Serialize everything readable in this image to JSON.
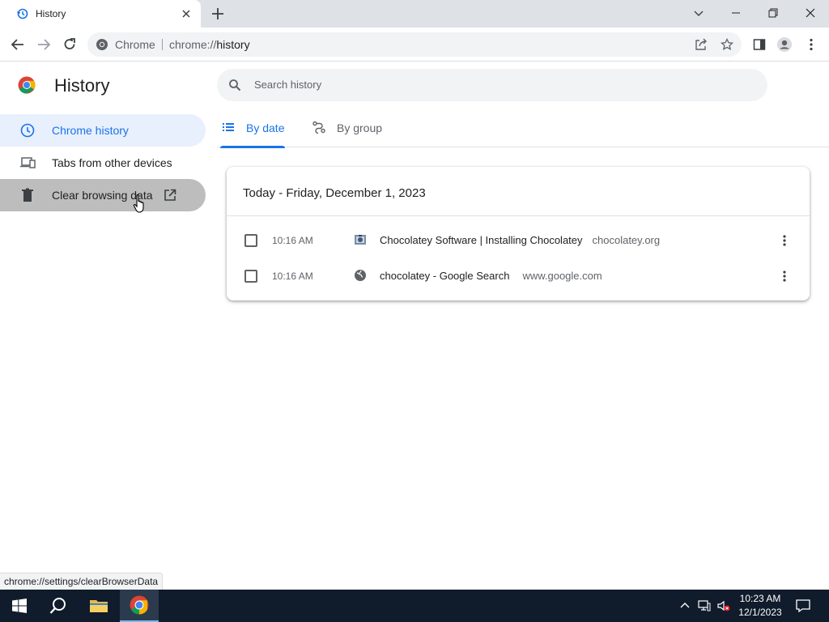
{
  "browser": {
    "tab_title": "History",
    "omnibox": {
      "chip": "Chrome",
      "url_scheme": "chrome://",
      "url_host": "history"
    }
  },
  "page": {
    "title": "History",
    "search_placeholder": "Search history",
    "sidebar": [
      {
        "label": "Chrome history",
        "icon": "clock-icon",
        "state": "selected"
      },
      {
        "label": "Tabs from other devices",
        "icon": "devices-icon",
        "state": "normal"
      },
      {
        "label": "Clear browsing data",
        "icon": "trash-icon",
        "state": "hover"
      }
    ],
    "view_tabs": [
      {
        "label": "By date",
        "icon": "list-icon",
        "selected": true
      },
      {
        "label": "By group",
        "icon": "group-icon",
        "selected": false
      }
    ],
    "card": {
      "date_heading": "Today - Friday, December 1, 2023",
      "entries": [
        {
          "time": "10:16 AM",
          "title": "Chocolatey Software | Installing Chocolatey",
          "domain": "chocolatey.org",
          "favicon": "chocolatey-favicon"
        },
        {
          "time": "10:16 AM",
          "title": "chocolatey - Google Search",
          "domain": "www.google.com",
          "favicon": "globe-icon"
        }
      ]
    }
  },
  "status_bar": "chrome://settings/clearBrowserData",
  "taskbar": {
    "clock_time": "10:23 AM",
    "clock_date": "12/1/2023"
  },
  "colors": {
    "accent": "#1a73e8",
    "tabstrip": "#dee1e6",
    "taskbar": "#101b2b"
  }
}
